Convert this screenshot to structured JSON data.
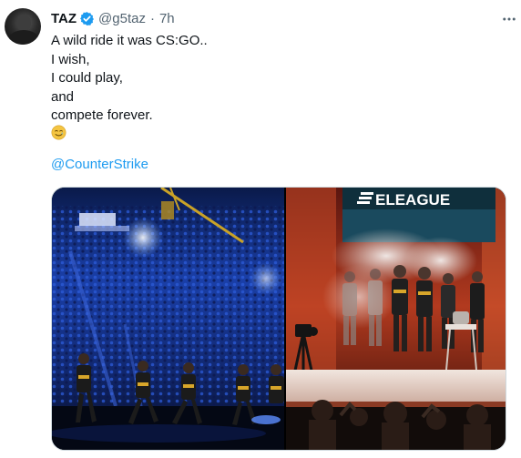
{
  "tweet": {
    "author_name": "TAZ",
    "handle": "@g5taz",
    "separator": "·",
    "time": "7h",
    "text_lines": [
      "A wild ride it was CS:GO..",
      "I wish,",
      "I could play,",
      "and",
      "compete forever."
    ],
    "emoji": "🥲",
    "mention": "@CounterStrike"
  },
  "media": {
    "right_banner_text": "ELEAGUE"
  },
  "icons": {
    "verified": "verified-badge-icon",
    "more": "more-options-icon"
  },
  "colors": {
    "verified_blue": "#1d9bf0",
    "link_blue": "#1d9bf0",
    "secondary_text": "#536471"
  }
}
